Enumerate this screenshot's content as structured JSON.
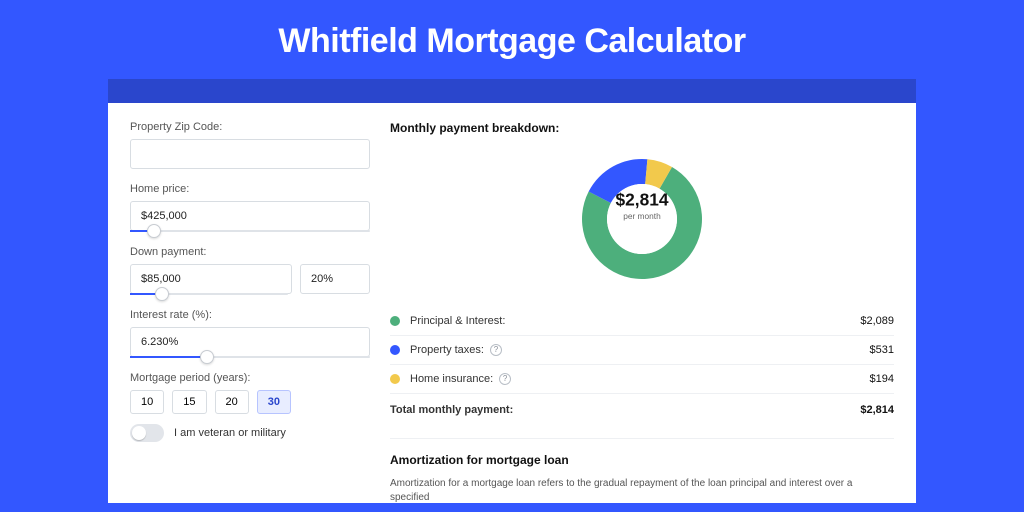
{
  "title": "Whitfield Mortgage Calculator",
  "colors": {
    "principal": "#4daf7c",
    "taxes": "#3357ff",
    "insurance": "#f2c94c"
  },
  "form": {
    "zip": {
      "label": "Property Zip Code:",
      "value": ""
    },
    "home_price": {
      "label": "Home price:",
      "value": "$425,000",
      "slider_pct": 10
    },
    "down_payment": {
      "label": "Down payment:",
      "amount": "$85,000",
      "percent": "20%",
      "slider_pct": 20
    },
    "interest_rate": {
      "label": "Interest rate (%):",
      "value": "6.230%",
      "slider_pct": 32
    },
    "period": {
      "label": "Mortgage period (years):",
      "options": [
        "10",
        "15",
        "20",
        "30"
      ],
      "selected": "30"
    },
    "veteran": {
      "label": "I am veteran or military",
      "on": false
    }
  },
  "breakdown": {
    "heading": "Monthly payment breakdown:",
    "center_amount": "$2,814",
    "center_sub": "per month",
    "items": [
      {
        "label": "Principal & Interest:",
        "value": "$2,089",
        "numeric": 2089,
        "color": "principal",
        "help": false
      },
      {
        "label": "Property taxes:",
        "value": "$531",
        "numeric": 531,
        "color": "taxes",
        "help": true
      },
      {
        "label": "Home insurance:",
        "value": "$194",
        "numeric": 194,
        "color": "insurance",
        "help": true
      }
    ],
    "total": {
      "label": "Total monthly payment:",
      "value": "$2,814"
    }
  },
  "chart_data": {
    "type": "pie",
    "title": "Monthly payment breakdown",
    "series": [
      {
        "name": "Principal & Interest",
        "value": 2089,
        "color": "#4daf7c"
      },
      {
        "name": "Property taxes",
        "value": 531,
        "color": "#3357ff"
      },
      {
        "name": "Home insurance",
        "value": 194,
        "color": "#f2c94c"
      }
    ],
    "center_label": "$2,814",
    "center_sub": "per month"
  },
  "amortization": {
    "heading": "Amortization for mortgage loan",
    "text": "Amortization for a mortgage loan refers to the gradual repayment of the loan principal and interest over a specified"
  }
}
